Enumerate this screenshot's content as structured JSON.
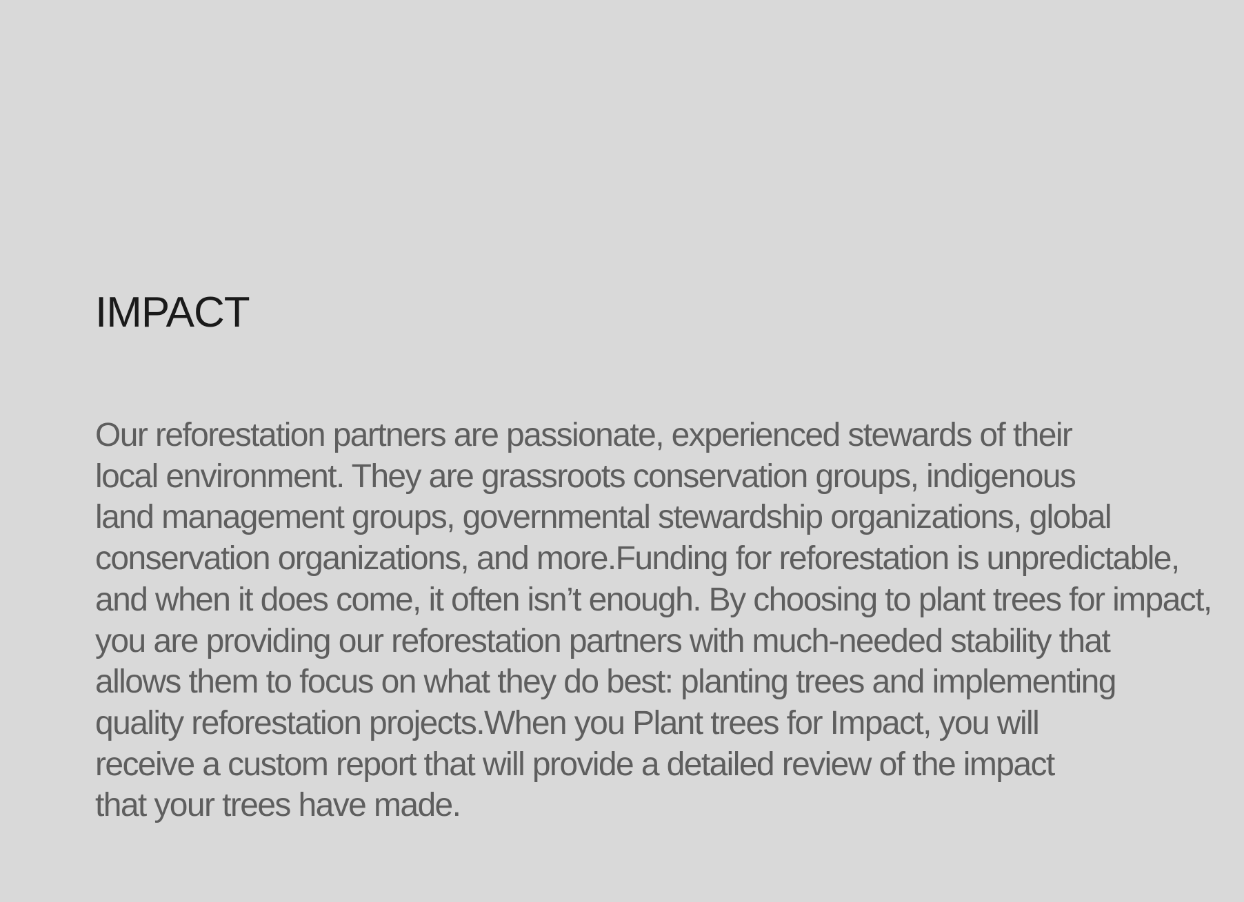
{
  "impact": {
    "title": "IMPACT",
    "lines": [
      "Our reforestation partners are passionate, experienced stewards of their",
      "local environment. They are grassroots conservation groups, indigenous",
      "land management groups, governmental stewardship organizations, global",
      "conservation organizations, and more.Funding for reforestation is unpredictable,",
      "and when it does come, it often isn’t enough. By choosing to plant trees for impact,",
      "you are providing our reforestation partners with much-needed stability that",
      "allows them to focus on what they do best: planting trees and implementing",
      "quality reforestation projects.When you Plant trees for Impact, you will",
      "receive a custom report that will provide a detailed review of the impact",
      "that your trees have made."
    ]
  }
}
